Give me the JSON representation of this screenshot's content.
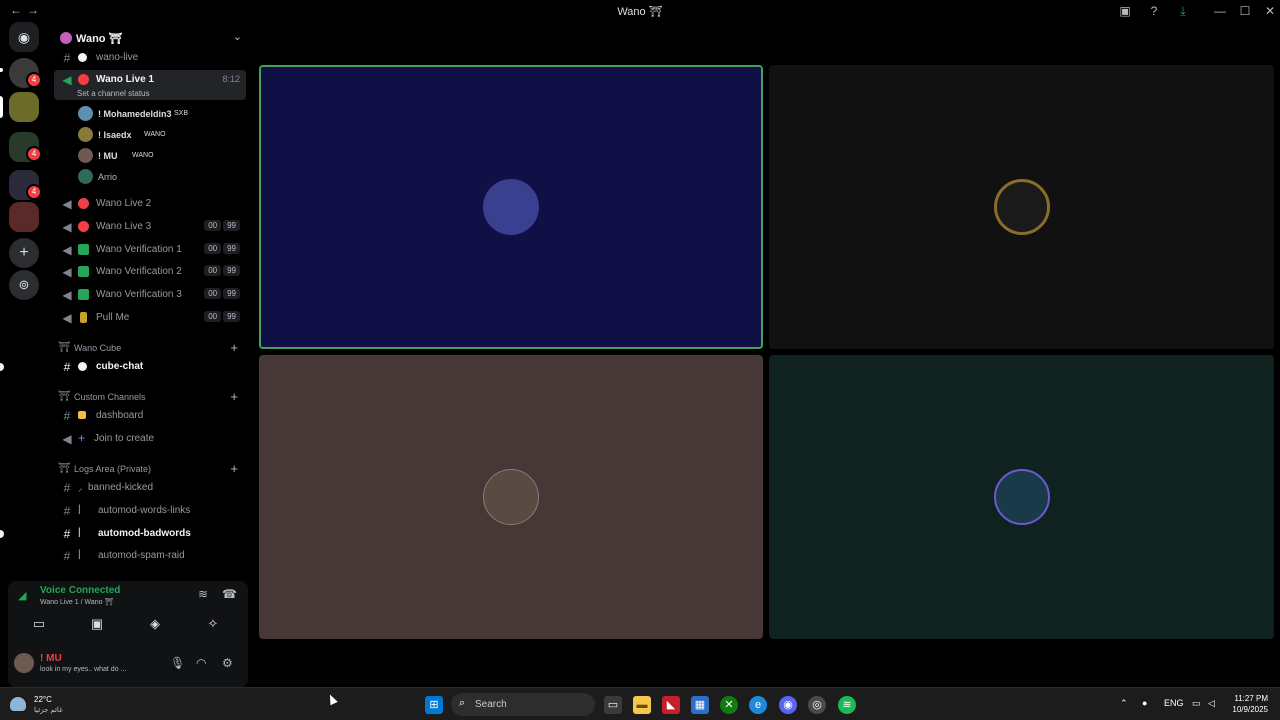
{
  "window": {
    "title": "Wano ⛩",
    "back": "←",
    "forward": "→",
    "inbox_glyph": "▣",
    "help_glyph": "?",
    "download_glyph": "⤓",
    "min_glyph": "—",
    "max_glyph": "☐",
    "close_glyph": "✕"
  },
  "rail": {
    "discord_glyph": "◉",
    "badges": [
      "4",
      "4",
      "4",
      "4"
    ],
    "add_glyph": "+",
    "explore_glyph": "⊚"
  },
  "guild": {
    "name": "Wano ⛩",
    "chevron": "⌄"
  },
  "channels": {
    "wano_live": "wano-live",
    "live1": "Wano Live 1",
    "live1_time": "8:12",
    "live1_status": "Set a channel status",
    "live1_users": [
      {
        "name": "! Mohamedeldin3",
        "tag": "SXB"
      },
      {
        "name": "! Isaedx",
        "tag": "WANO"
      },
      {
        "name": "! MU",
        "tag": "WANO"
      },
      {
        "name": "Arrio",
        "tag": ""
      }
    ],
    "voice_rows": [
      {
        "label": "Wano Live 2",
        "c1": "",
        "c2": ""
      },
      {
        "label": "Wano Live 3",
        "c1": "00",
        "c2": "99"
      },
      {
        "label": "Wano Verification 1",
        "c1": "00",
        "c2": "99"
      },
      {
        "label": "Wano Verification 2",
        "c1": "00",
        "c2": "99"
      },
      {
        "label": "Wano Verification 3",
        "c1": "00",
        "c2": "99"
      },
      {
        "label": "Pull Me",
        "c1": "00",
        "c2": "99"
      }
    ],
    "cat_cube": "Wano Cube",
    "cube_chat": "cube-chat",
    "cat_custom": "Custom Channels",
    "dashboard": "dashboard",
    "join_create": "Join to create",
    "cat_logs": "Logs Area (Private)",
    "banned": "banned-kicked",
    "words_links": "automod-words-links",
    "badwords": "automod-badwords",
    "spam": "automod-spam-raid",
    "separator": "・",
    "add": "+"
  },
  "voice": {
    "title": "Voice Connected",
    "subtitle": "Wano Live 1 / Wano ⛩",
    "user_name": "! MU",
    "user_status": "look in my eyes.. what do ..."
  },
  "tiles": [
    {
      "color": "#111046",
      "avatar": "#3a3f8f"
    },
    {
      "color": "#111111",
      "avatar": "#8a6d2a"
    },
    {
      "color": "#463836",
      "avatar": "#5a4a44"
    },
    {
      "color": "#0f2220",
      "avatar": "#2f6a8a"
    }
  ],
  "taskbar": {
    "temp": "22°C",
    "weather_desc": "غائم جزئيا",
    "search_placeholder": "Search",
    "lang": "ENG",
    "time": "11:27 PM",
    "date": "10/9/2025"
  },
  "colors": {
    "accent_green": "#23a55a",
    "danger": "#f23f43",
    "speaking_border": "#43a25a"
  }
}
